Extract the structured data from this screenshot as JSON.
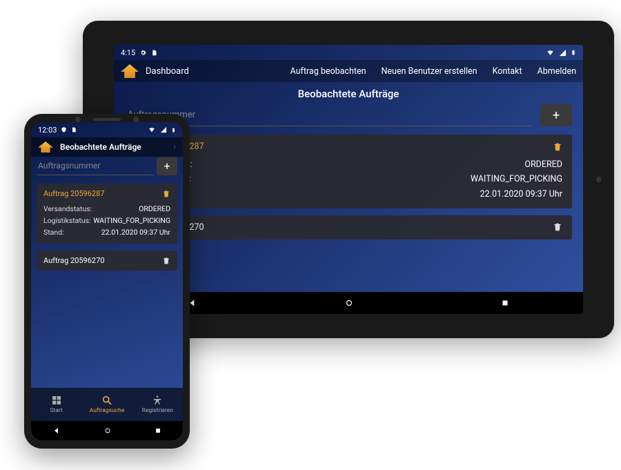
{
  "tablet": {
    "status": {
      "time": "4:15"
    },
    "nav": {
      "title": "Dashboard",
      "items": [
        "Auftrag beobachten",
        "Neuen Benutzer erstellen",
        "Kontakt",
        "Abmelden"
      ]
    },
    "page_title": "Beobachtete Aufträge",
    "search_placeholder": "Auftragsnummer",
    "orders": [
      {
        "title": "Auftrag 20596287",
        "expanded": true,
        "rows": [
          {
            "label": "Versandstatus:",
            "value": "ORDERED"
          },
          {
            "label": "Logistikstatus:",
            "value": "WAITING_FOR_PICKING"
          },
          {
            "label": "Stand:",
            "value": "22.01.2020 09:37 Uhr"
          }
        ]
      },
      {
        "title": "Auftrag 20596270",
        "expanded": false
      }
    ]
  },
  "phone": {
    "status": {
      "time": "12:03"
    },
    "header_title": "Beobachtete Aufträge",
    "search_placeholder": "Auftragsnummer",
    "orders": [
      {
        "title": "Auftrag 20596287",
        "expanded": true,
        "rows": [
          {
            "label": "Versandstatus:",
            "value": "ORDERED"
          },
          {
            "label": "Logistikstatus:",
            "value": "WAITING_FOR_PICKING"
          },
          {
            "label": "Stand:",
            "value": "22.01.2020 09:37 Uhr"
          }
        ]
      },
      {
        "title": "Auftrag 20596270",
        "expanded": false
      }
    ],
    "bottom_nav": [
      {
        "label": "Start"
      },
      {
        "label": "Auftragsuche"
      },
      {
        "label": "Registrieren"
      }
    ]
  }
}
